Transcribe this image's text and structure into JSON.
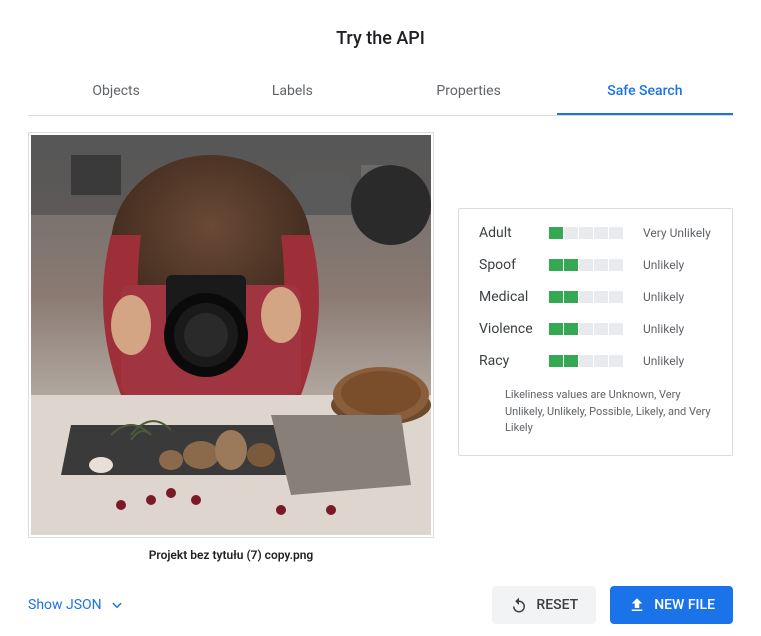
{
  "title": "Try the API",
  "tabs": {
    "objects": "Objects",
    "labels": "Labels",
    "properties": "Properties",
    "safesearch": "Safe Search"
  },
  "filename": "Projekt bez tytułu (7) copy.png",
  "results": [
    {
      "label": "Adult",
      "segments": 1,
      "value": "Very Unlikely"
    },
    {
      "label": "Spoof",
      "segments": 2,
      "value": "Unlikely"
    },
    {
      "label": "Medical",
      "segments": 2,
      "value": "Unlikely"
    },
    {
      "label": "Violence",
      "segments": 2,
      "value": "Unlikely"
    },
    {
      "label": "Racy",
      "segments": 2,
      "value": "Unlikely"
    }
  ],
  "hint": "Likeliness values are Unknown, Very Unlikely, Unlikely, Possible, Likely, and Very Likely",
  "footer": {
    "show_json": "Show JSON",
    "reset": "RESET",
    "newfile": "NEW FILE"
  }
}
